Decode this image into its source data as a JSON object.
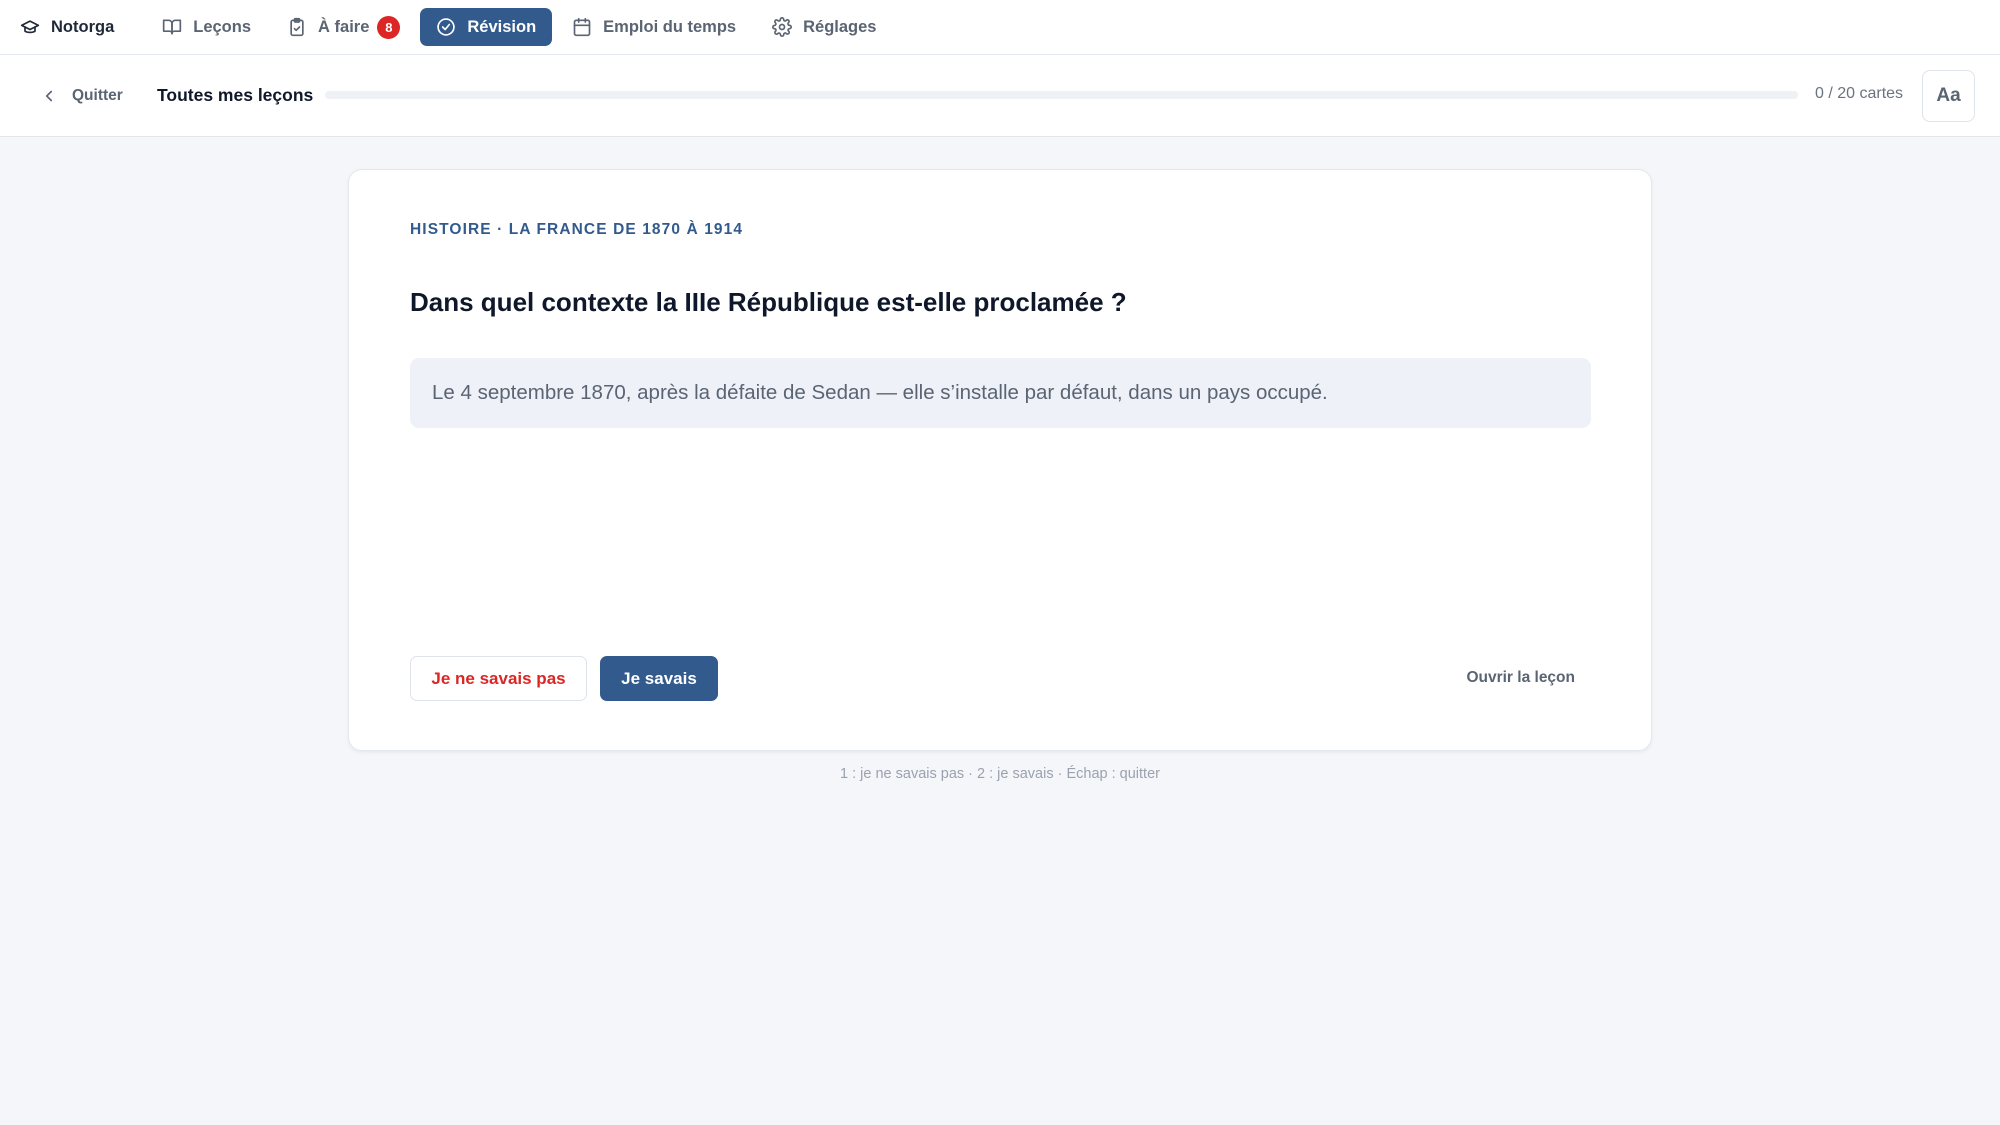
{
  "nav": {
    "brand": "Notorga",
    "items": [
      {
        "label": "Leçons"
      },
      {
        "label": "À faire",
        "badge": "8"
      },
      {
        "label": "Révision"
      },
      {
        "label": "Emploi du temps"
      },
      {
        "label": "Réglages"
      }
    ],
    "active": "Révision"
  },
  "session": {
    "quit_label": "Quitter",
    "title": "Toutes mes leçons",
    "progress_text": "0 / 20 cartes",
    "progress_fraction": 0,
    "font_button_label": "Aa"
  },
  "card": {
    "eyebrow": "HISTOIRE · LA FRANCE DE 1870 À 1914",
    "question": "Dans quel contexte la IIIe République est-elle proclamée ?",
    "answer": "Le 4 septembre 1870, après la défaite de Sedan — elle s’installe par défaut, dans un pays occupé.",
    "btn_fail": "Je ne savais pas",
    "btn_ok": "Je savais",
    "open_lesson": "Ouvrir la leçon"
  },
  "hint": "1 : je ne savais pas · 2 : je savais · Échap : quitter",
  "colors": {
    "accent": "#335a8d",
    "danger": "#dc2626",
    "background": "#f4f6fa"
  },
  "icons": {
    "brand": "graduation-cap-icon",
    "lessons": "book-open-icon",
    "todo": "clipboard-check-icon",
    "review": "check-circle-icon",
    "schedule": "calendar-icon",
    "settings": "gear-icon",
    "back": "chevron-left-icon"
  }
}
